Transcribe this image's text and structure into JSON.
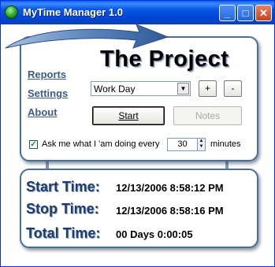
{
  "window": {
    "title": "MyTime Manager 1.0"
  },
  "title_buttons": {
    "minimize": "_",
    "maximize": "□",
    "close": "✕"
  },
  "project": {
    "title": "The Project"
  },
  "nav": {
    "reports": "Reports",
    "settings": "Settings",
    "about": "About"
  },
  "activity": {
    "selected": "Work Day"
  },
  "buttons": {
    "add": "+",
    "remove": "-",
    "start": "Start",
    "notes": "Notes"
  },
  "reminder": {
    "checked": true,
    "label": "Ask me what I 'am doing every",
    "interval": "30",
    "unit": "minutes"
  },
  "stats": {
    "start_label": "Start Time:",
    "start_value": "12/13/2006 8:58:12 PM",
    "stop_label": "Stop Time:",
    "stop_value": "12/13/2006 8:58:16 PM",
    "total_label": "Total Time:",
    "total_value": "00 Days 0:00:05"
  },
  "colors": {
    "titlebar": "#0a58e6",
    "panel_border": "#4a6f9a",
    "link": "#3b5c8c",
    "stat_label": "#1f3d70"
  },
  "icons": {
    "app": "green-globe-icon",
    "arrow": "swoosh-arrow-graphic",
    "check": "checkmark-icon"
  }
}
